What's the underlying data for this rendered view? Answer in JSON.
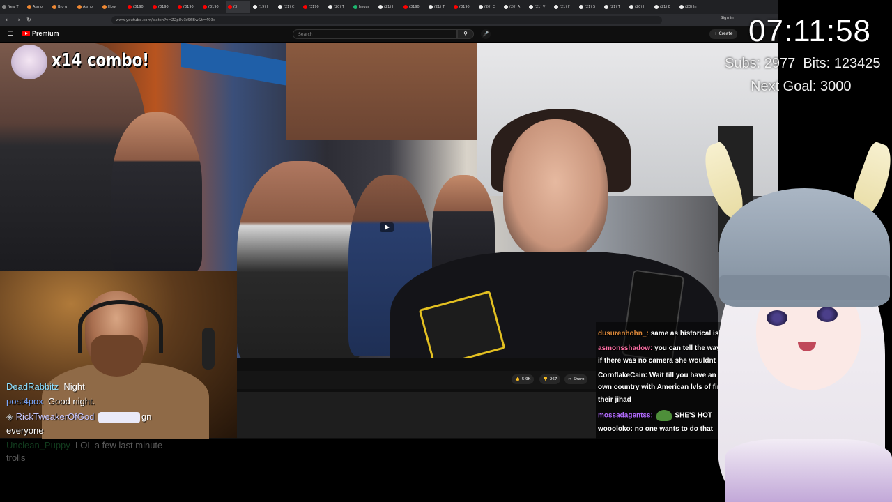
{
  "browser": {
    "tabs": [
      {
        "label": "New T",
        "color": "#888"
      },
      {
        "label": "Asmo",
        "color": "#e83"
      },
      {
        "label": "Bro g",
        "color": "#e83"
      },
      {
        "label": "Asmo",
        "color": "#e83"
      },
      {
        "label": "How",
        "color": "#e83"
      },
      {
        "label": "(3190",
        "color": "#f00"
      },
      {
        "label": "(3190",
        "color": "#f00"
      },
      {
        "label": "(3190",
        "color": "#f00"
      },
      {
        "label": "(3190",
        "color": "#f00"
      },
      {
        "label": "(3",
        "color": "#f00"
      },
      {
        "label": "(19) I",
        "color": "#eee"
      },
      {
        "label": "(21) C",
        "color": "#eee"
      },
      {
        "label": "(3190",
        "color": "#f00"
      },
      {
        "label": "(20) T",
        "color": "#eee"
      },
      {
        "label": "Imgur",
        "color": "#1bb76e"
      },
      {
        "label": "(21) I",
        "color": "#eee"
      },
      {
        "label": "(3190",
        "color": "#f00"
      },
      {
        "label": "(21) T",
        "color": "#eee"
      },
      {
        "label": "(3190",
        "color": "#f00"
      },
      {
        "label": "(20) C",
        "color": "#eee"
      },
      {
        "label": "(20) A",
        "color": "#eee"
      },
      {
        "label": "(21) V",
        "color": "#eee"
      },
      {
        "label": "(21) F",
        "color": "#eee"
      },
      {
        "label": "(21) S",
        "color": "#eee"
      },
      {
        "label": "(21) T",
        "color": "#eee"
      },
      {
        "label": "(20) I",
        "color": "#eee"
      },
      {
        "label": "(21) E",
        "color": "#eee"
      },
      {
        "label": "(20) In",
        "color": "#eee"
      }
    ],
    "url": "www.youtube.com/watch?v=Z2p8v3rS6Bw&t=493s"
  },
  "youtube": {
    "logo_label": "Premium",
    "search_placeholder": "Search",
    "sign_in": "Sign in",
    "create_label": "Create",
    "likes": "5.9K",
    "dislikes": "267",
    "share": "Share"
  },
  "overlay": {
    "clock": "07:11:58",
    "subs_label": "Subs:",
    "subs_value": "2977",
    "bits_label": "Bits:",
    "bits_value": "123425",
    "goal_label": "Next Goal:",
    "goal_value": "3000",
    "combo": "x14 combo!"
  },
  "webcam_chat": [
    {
      "user": "DeadRabbitz",
      "user_color": "#8fe0ff",
      "message": "Night"
    },
    {
      "user": "post4pox",
      "user_color": "#7aa8ff",
      "message": "Good night."
    },
    {
      "user": "RickTweakerOfGod",
      "user_color": "#c9c9ff",
      "message": "gn"
    },
    {
      "user": "",
      "user_color": "#ffffff",
      "message": "everyone"
    },
    {
      "user": "Unclean_Puppy",
      "user_color": "#33aa55",
      "message": "LOL a few last minute"
    },
    {
      "user": "",
      "user_color": "#ffffff",
      "message": "trolls"
    }
  ],
  "stream_chat": [
    {
      "user": "dusurenhohn_:",
      "user_color": "#e08a3a",
      "message": "same as historical islam it ne"
    },
    {
      "user": "asmonsshadow:",
      "user_color": "#ff6fa5",
      "message": "you can tell the way there lo"
    },
    {
      "user": "",
      "user_color": "#ffffff",
      "message": "if there was no camera she wouldnt be alive"
    },
    {
      "user": "CornflakeCain:",
      "user_color": "#ffffff",
      "message": "Wait till you have an insurgency i"
    },
    {
      "user": "",
      "user_color": "#ffffff",
      "message": "own country with American lvls of firearms avail"
    },
    {
      "user": "",
      "user_color": "#ffffff",
      "message": "their jihad"
    },
    {
      "user": "mossadagentss:",
      "user_color": "#b36cff",
      "message": "SHE'S HOT"
    },
    {
      "user": "woooloko:",
      "user_color": "#ffffff",
      "message": "no one wants to do that"
    }
  ]
}
